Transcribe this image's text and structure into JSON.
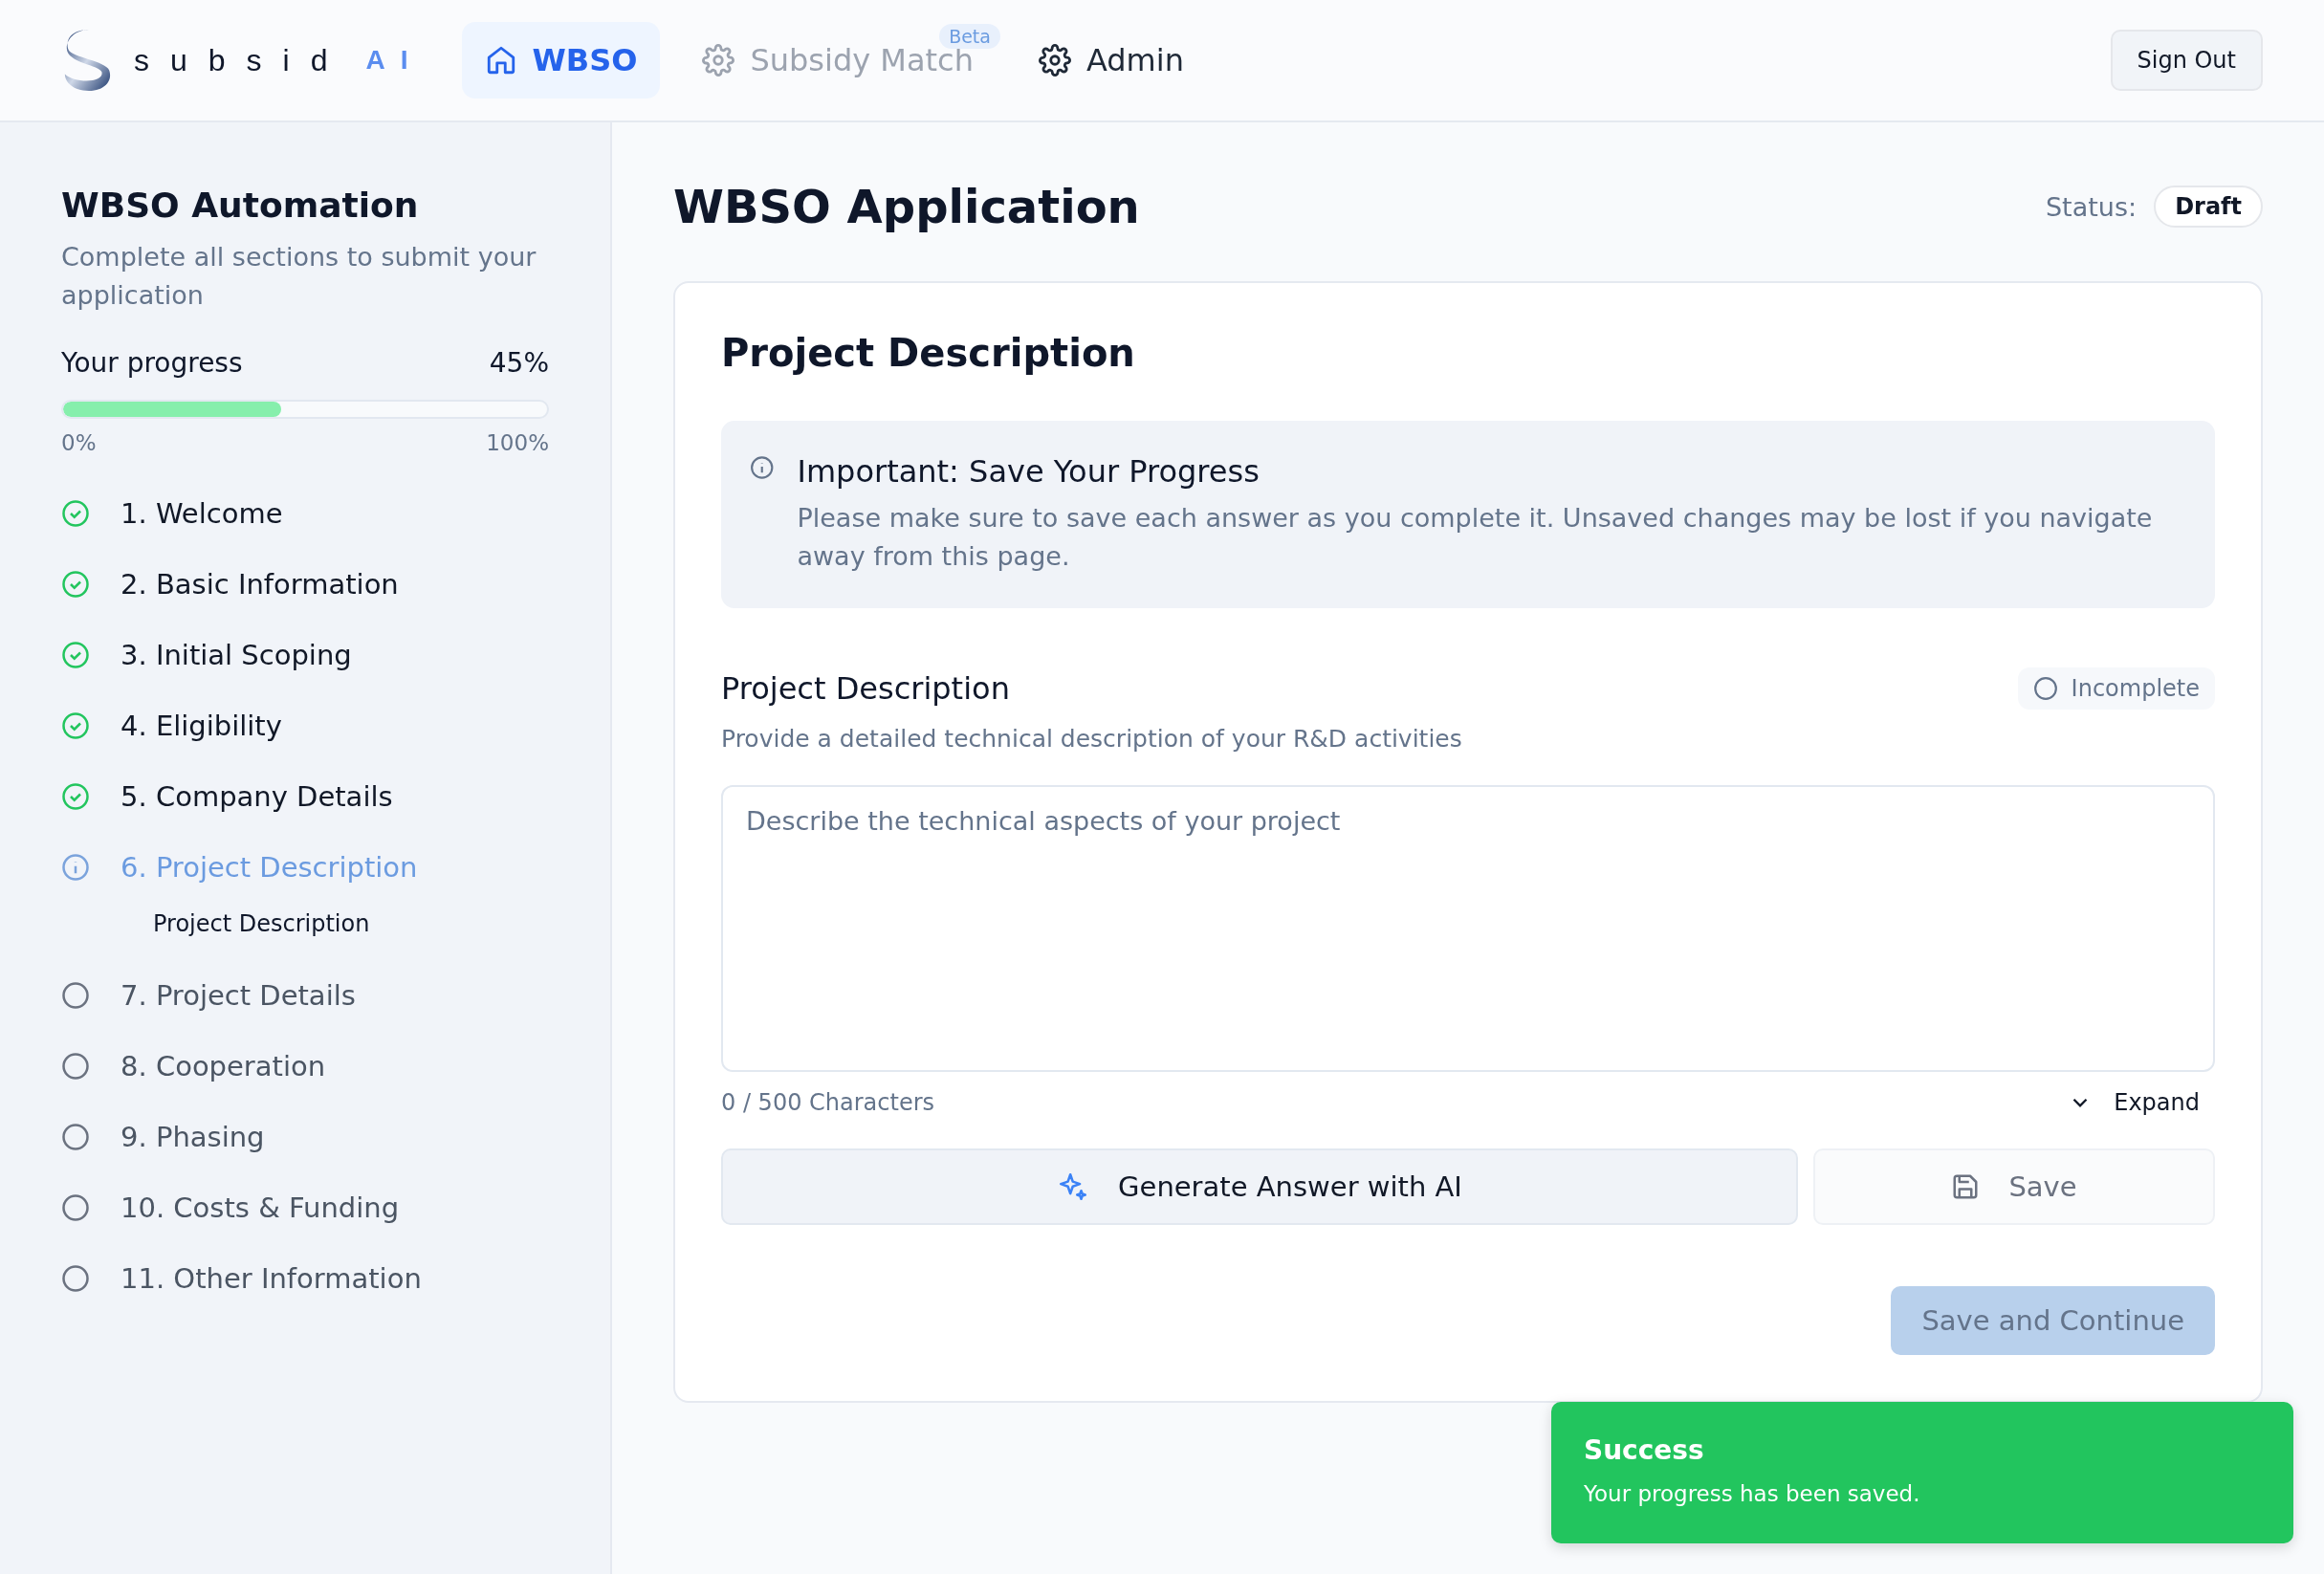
{
  "header": {
    "logo_text": "subsid",
    "logo_accent": "AI",
    "tabs": [
      {
        "label": "WBSO",
        "selected": true,
        "disabled": false
      },
      {
        "label": "Subsidy Match",
        "selected": false,
        "disabled": true,
        "badge": "Beta"
      },
      {
        "label": "Admin",
        "selected": false,
        "disabled": false
      }
    ],
    "sign_out": "Sign Out"
  },
  "sidebar": {
    "title": "WBSO Automation",
    "subtitle": "Complete all sections to submit your application",
    "progress": {
      "label": "Your progress",
      "reading": "45%",
      "level": 0.45,
      "min": "0%",
      "max": "100%"
    },
    "steps": [
      {
        "label": "1. Welcome",
        "completed": true,
        "selected": false
      },
      {
        "label": "2. Basic Information",
        "completed": true,
        "selected": false
      },
      {
        "label": "3. Initial Scoping",
        "completed": true,
        "selected": false
      },
      {
        "label": "4. Eligibility",
        "completed": true,
        "selected": false
      },
      {
        "label": "5. Company Details",
        "completed": true,
        "selected": false
      },
      {
        "label": "6. Project Description",
        "completed": false,
        "selected": true,
        "children": [
          {
            "label": "Project Description"
          }
        ]
      },
      {
        "label": "7. Project Details",
        "completed": false,
        "selected": false
      },
      {
        "label": "8. Cooperation",
        "completed": false,
        "selected": false
      },
      {
        "label": "9. Phasing",
        "completed": false,
        "selected": false
      },
      {
        "label": "10. Costs & Funding",
        "completed": false,
        "selected": false
      },
      {
        "label": "11. Other Information",
        "completed": false,
        "selected": false
      }
    ]
  },
  "main": {
    "title": "WBSO Application",
    "status_label": "Status:",
    "status": "Draft",
    "card": {
      "title": "Project Description",
      "notice": {
        "title": "Important: Save Your Progress",
        "text": "Please make sure to save each answer as you complete it. Unsaved changes may be lost if you navigate away from this page."
      },
      "question": {
        "title": "Project Description",
        "state": "Incomplete",
        "hint": "Provide a detailed technical description of your R&D activities",
        "placeholder": "Describe the technical aspects of your project",
        "count": "0 / 500 Characters",
        "expand": "Expand"
      },
      "generate": "Generate Answer with AI",
      "save": "Save",
      "continue": {
        "label": "Save and Continue",
        "disabled": true
      }
    }
  },
  "toast": {
    "title": "Success",
    "text": "Your progress has been saved."
  }
}
